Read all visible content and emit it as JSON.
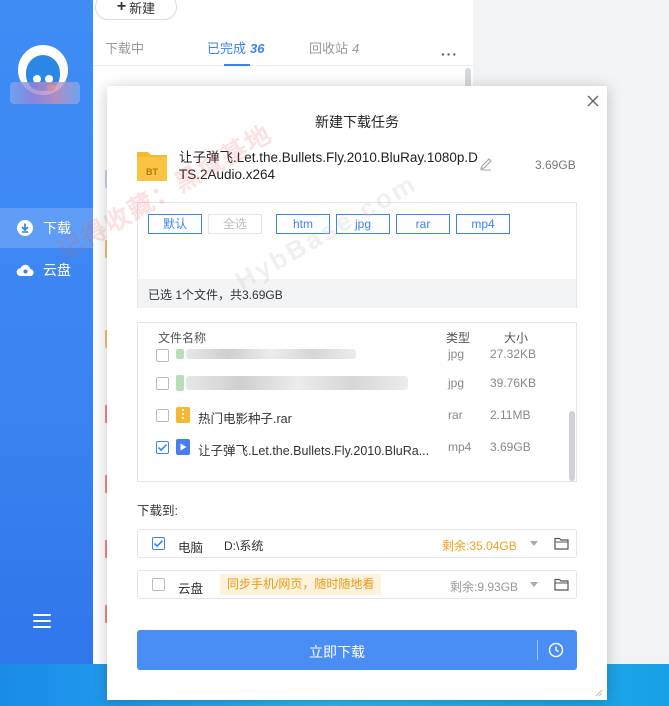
{
  "sidebar": {
    "nav": [
      {
        "label": "下载",
        "icon": "download-icon"
      },
      {
        "label": "云盘",
        "icon": "cloud-icon"
      }
    ]
  },
  "main": {
    "new_button": "新建",
    "tabs": [
      {
        "label": "下载中",
        "count": ""
      },
      {
        "label": "已完成",
        "count": "36"
      },
      {
        "label": "回收站",
        "count": "4"
      }
    ],
    "more": "···"
  },
  "dialog": {
    "title": "新建下载任务",
    "file": {
      "icon_label": "BT",
      "name": "让子弹飞.Let.the.Bullets.Fly.2010.BluRay.1080p.DTS.2Audio.x264",
      "size": "3.69GB"
    },
    "filters": [
      "默认",
      "全选",
      "htm",
      "jpg",
      "rar",
      "mp4"
    ],
    "selection_status": "已选 1个文件，共3.69GB",
    "columns": {
      "name": "文件名称",
      "type": "类型",
      "size": "大小"
    },
    "files": [
      {
        "name": "",
        "type": "jpg",
        "size": "27.32KB",
        "checked": false,
        "blurred": true
      },
      {
        "name": "",
        "type": "jpg",
        "size": "39.76KB",
        "checked": false,
        "blurred": true
      },
      {
        "name": "热门电影种子.rar",
        "type": "rar",
        "size": "2.11MB",
        "checked": false,
        "blurred": false
      },
      {
        "name": "让子弹飞.Let.the.Bullets.Fly.2010.BluRa...",
        "type": "mp4",
        "size": "3.69GB",
        "checked": true,
        "blurred": false
      }
    ],
    "download_to_label": "下载到:",
    "destinations": [
      {
        "name": "电脑",
        "path": "D:\\系统",
        "free": "剩余:35.04GB",
        "checked": true
      },
      {
        "name": "云盘",
        "promo": "同步手机/网页，随时随地看",
        "free": "剩余:9.93GB",
        "checked": false
      }
    ],
    "download_button": "立即下载"
  },
  "watermarks": [
    "记得收藏：黑域基地",
    "HybBase.com"
  ],
  "colors": {
    "accent": "#3a84f2",
    "button": "#4a8df5",
    "warning": "#f0a020",
    "sidebar": "#3f8cf5"
  }
}
